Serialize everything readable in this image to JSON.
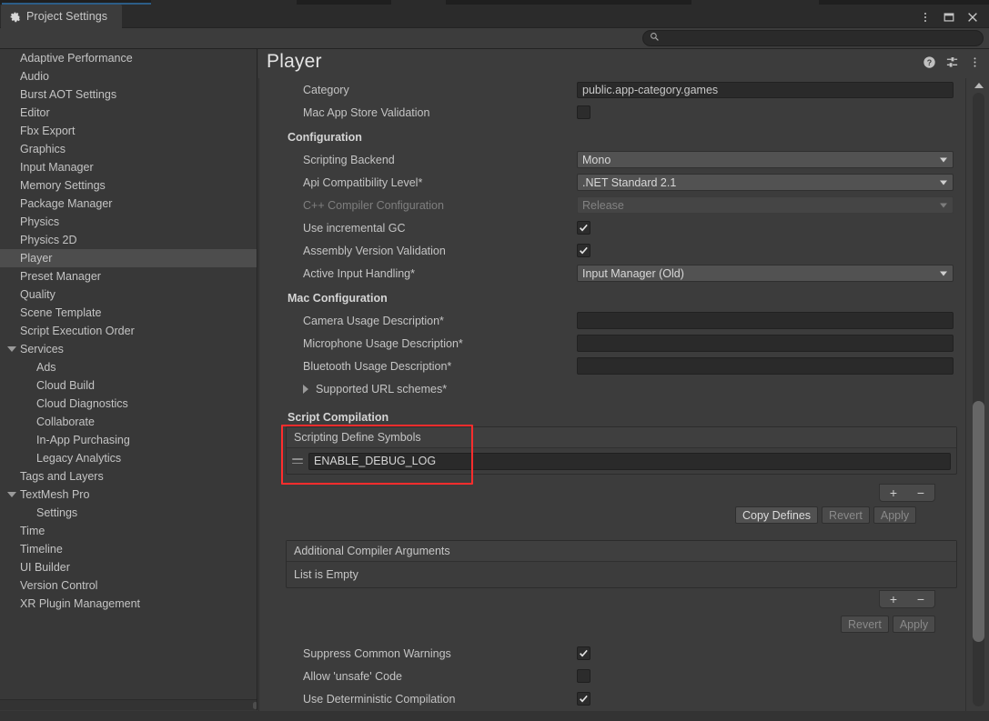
{
  "window": {
    "tab_label": "Project Settings",
    "tab_icon": "gear-icon",
    "menu_icon": "kebab-menu-icon",
    "maximize_icon": "maximize-icon",
    "close_icon": "close-icon"
  },
  "search": {
    "value": "",
    "placeholder": "",
    "icon": "search-icon"
  },
  "sidebar": {
    "items": [
      {
        "label": "Adaptive Performance",
        "level": 1,
        "expandable": false,
        "selected": false
      },
      {
        "label": "Audio",
        "level": 1,
        "expandable": false,
        "selected": false
      },
      {
        "label": "Burst AOT Settings",
        "level": 1,
        "expandable": false,
        "selected": false
      },
      {
        "label": "Editor",
        "level": 1,
        "expandable": false,
        "selected": false
      },
      {
        "label": "Fbx Export",
        "level": 1,
        "expandable": false,
        "selected": false
      },
      {
        "label": "Graphics",
        "level": 1,
        "expandable": false,
        "selected": false
      },
      {
        "label": "Input Manager",
        "level": 1,
        "expandable": false,
        "selected": false
      },
      {
        "label": "Memory Settings",
        "level": 1,
        "expandable": false,
        "selected": false
      },
      {
        "label": "Package Manager",
        "level": 1,
        "expandable": false,
        "selected": false
      },
      {
        "label": "Physics",
        "level": 1,
        "expandable": false,
        "selected": false
      },
      {
        "label": "Physics 2D",
        "level": 1,
        "expandable": false,
        "selected": false
      },
      {
        "label": "Player",
        "level": 1,
        "expandable": false,
        "selected": true
      },
      {
        "label": "Preset Manager",
        "level": 1,
        "expandable": false,
        "selected": false
      },
      {
        "label": "Quality",
        "level": 1,
        "expandable": false,
        "selected": false
      },
      {
        "label": "Scene Template",
        "level": 1,
        "expandable": false,
        "selected": false
      },
      {
        "label": "Script Execution Order",
        "level": 1,
        "expandable": false,
        "selected": false
      },
      {
        "label": "Services",
        "level": 1,
        "expandable": true,
        "selected": false
      },
      {
        "label": "Ads",
        "level": 2,
        "expandable": false,
        "selected": false
      },
      {
        "label": "Cloud Build",
        "level": 2,
        "expandable": false,
        "selected": false
      },
      {
        "label": "Cloud Diagnostics",
        "level": 2,
        "expandable": false,
        "selected": false
      },
      {
        "label": "Collaborate",
        "level": 2,
        "expandable": false,
        "selected": false
      },
      {
        "label": "In-App Purchasing",
        "level": 2,
        "expandable": false,
        "selected": false
      },
      {
        "label": "Legacy Analytics",
        "level": 2,
        "expandable": false,
        "selected": false
      },
      {
        "label": "Tags and Layers",
        "level": 1,
        "expandable": false,
        "selected": false
      },
      {
        "label": "TextMesh Pro",
        "level": 1,
        "expandable": true,
        "selected": false
      },
      {
        "label": "Settings",
        "level": 2,
        "expandable": false,
        "selected": false
      },
      {
        "label": "Time",
        "level": 1,
        "expandable": false,
        "selected": false
      },
      {
        "label": "Timeline",
        "level": 1,
        "expandable": false,
        "selected": false
      },
      {
        "label": "UI Builder",
        "level": 1,
        "expandable": false,
        "selected": false
      },
      {
        "label": "Version Control",
        "level": 1,
        "expandable": false,
        "selected": false
      },
      {
        "label": "XR Plugin Management",
        "level": 1,
        "expandable": false,
        "selected": false
      }
    ]
  },
  "panel": {
    "title": "Player",
    "help_icon": "help-icon",
    "preset_icon": "preset-settings-icon",
    "more_icon": "kebab-menu-icon"
  },
  "rows": {
    "category_label": "Category",
    "category_value": "public.app-category.games",
    "mac_app_store_validation_label": "Mac App Store Validation",
    "configuration_header": "Configuration",
    "scripting_backend_label": "Scripting Backend",
    "scripting_backend_value": "Mono",
    "api_compat_label": "Api Compatibility Level*",
    "api_compat_value": ".NET Standard 2.1",
    "cpp_compiler_label": "C++ Compiler Configuration",
    "cpp_compiler_value": "Release",
    "incremental_gc_label": "Use incremental GC",
    "assembly_validation_label": "Assembly Version Validation",
    "active_input_label": "Active Input Handling*",
    "active_input_value": "Input Manager (Old)",
    "mac_configuration_header": "Mac Configuration",
    "camera_usage_label": "Camera Usage Description*",
    "camera_usage_value": "",
    "microphone_usage_label": "Microphone Usage Description*",
    "microphone_usage_value": "",
    "bluetooth_usage_label": "Bluetooth Usage Description*",
    "bluetooth_usage_value": "",
    "supported_url_schemes_label": "Supported URL schemes*",
    "script_compilation_header": "Script Compilation",
    "scripting_define_symbols_header": "Scripting Define Symbols",
    "define_symbol_0": "ENABLE_DEBUG_LOG",
    "copy_defines_label": "Copy Defines",
    "revert_label": "Revert",
    "apply_label": "Apply",
    "additional_compiler_args_header": "Additional Compiler Arguments",
    "additional_compiler_args_empty": "List is Empty",
    "revert2_label": "Revert",
    "apply2_label": "Apply",
    "suppress_warnings_label": "Suppress Common Warnings",
    "allow_unsafe_label": "Allow 'unsafe' Code",
    "deterministic_label": "Use Deterministic Compilation",
    "plus_label": "+",
    "minus_label": "−"
  },
  "colors": {
    "accent_blue": "#2c5d87",
    "highlight_red": "#ff2d2d",
    "panel_bg": "#3c3c3c",
    "sidebar_bg": "#383838",
    "selected_bg": "#4d4d4d"
  }
}
